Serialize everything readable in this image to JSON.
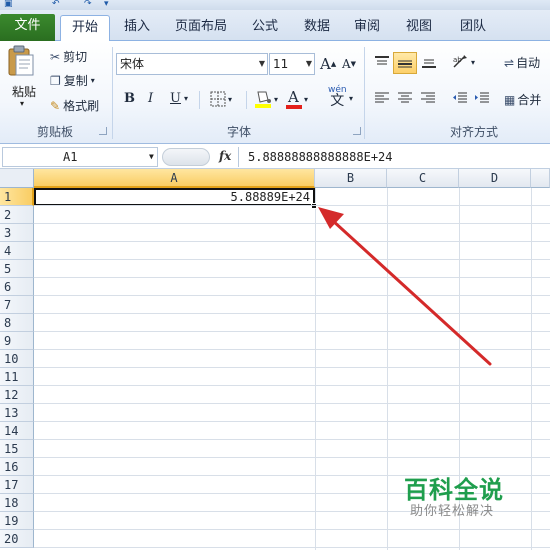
{
  "tabs": [
    {
      "label": "文件"
    },
    {
      "label": "开始"
    },
    {
      "label": "插入"
    },
    {
      "label": "页面布局"
    },
    {
      "label": "公式"
    },
    {
      "label": "数据"
    },
    {
      "label": "审阅"
    },
    {
      "label": "视图"
    },
    {
      "label": "团队"
    }
  ],
  "clipboard": {
    "paste": "粘贴",
    "cut": "剪切",
    "copy": "复制",
    "format_painter": "格式刷",
    "group": "剪贴板"
  },
  "font": {
    "name": "宋体",
    "size": "11",
    "group": "字体",
    "bold": "B",
    "italic": "I",
    "underline": "U",
    "grow": "A",
    "shrink": "A",
    "wen": "wén",
    "wen_char": "文"
  },
  "alignment": {
    "group": "对齐方式",
    "wrap": "自动",
    "merge": "合并"
  },
  "formula_bar": {
    "name_box": "A1",
    "fx": "fx",
    "value": "5.88888888888888E+24"
  },
  "columns": [
    "A",
    "B",
    "C",
    "D"
  ],
  "rows": [
    "1",
    "2",
    "3",
    "4",
    "5",
    "6",
    "7",
    "8",
    "9",
    "10",
    "11",
    "12",
    "13",
    "14",
    "15",
    "16",
    "17",
    "18",
    "19",
    "20"
  ],
  "cell_a1": "5.88889E+24",
  "watermark": {
    "title": "百科全说",
    "subtitle": "助你轻松解决"
  },
  "colors": {
    "accent": "#1f9e4d",
    "arrow": "#d42a2a",
    "selection": "#f9cd64"
  }
}
